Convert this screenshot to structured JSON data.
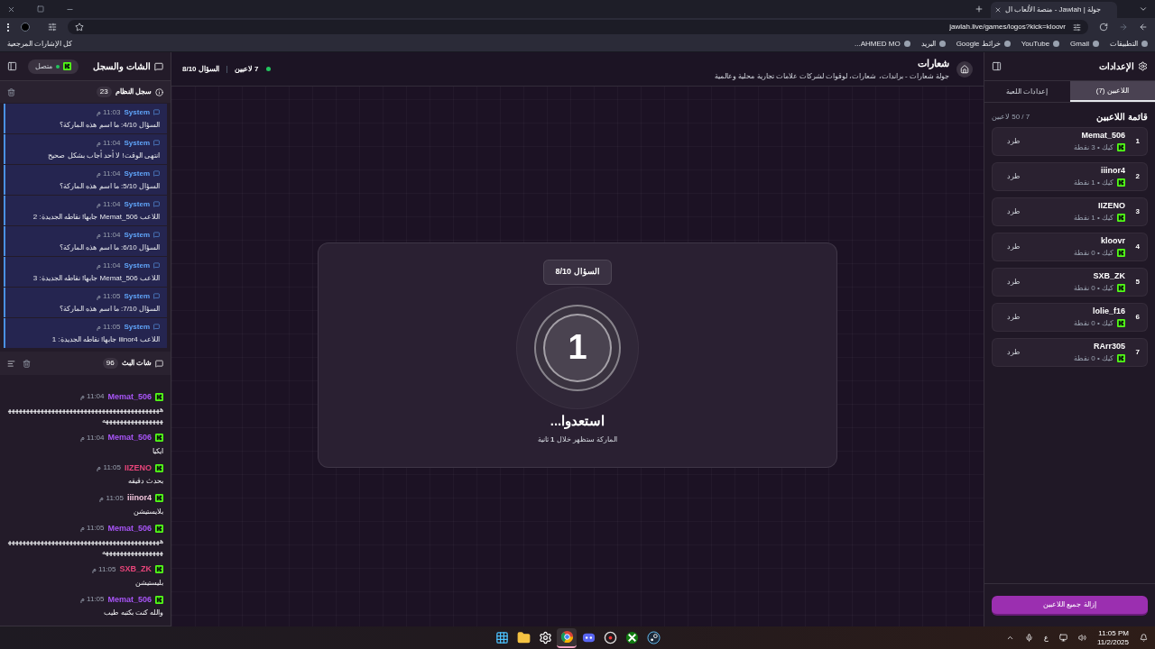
{
  "browser": {
    "tab": {
      "title": "جولة | Jawlah - منصة الألعاب ال",
      "selected": true
    },
    "address": "jawlah.live/games/logos?kick=kloovr",
    "bookmarks": [
      "التطبيقات",
      "Gmail",
      "YouTube",
      "خرائط Google",
      "البريد",
      "AHMED MO..."
    ],
    "all_bookmarks": "كل الإشارات المرجعية"
  },
  "settings": {
    "title": "الإعدادات",
    "tabs": [
      {
        "label": "اللاعبين (7)",
        "selected": true
      },
      {
        "label": "إعدادات اللعبة",
        "selected": false
      }
    ],
    "list_title": "قائمة اللاعبين",
    "count": "7 / 50 لاعبين",
    "players": [
      {
        "rank": "1",
        "name": "Memat_506",
        "meta": "كيك • 3 نقطة",
        "kick": "طرد"
      },
      {
        "rank": "2",
        "name": "iiinor4",
        "meta": "كيك • 1 نقطة",
        "kick": "طرد"
      },
      {
        "rank": "3",
        "name": "IIZENO",
        "meta": "كيك • 1 نقطة",
        "kick": "طرد"
      },
      {
        "rank": "4",
        "name": "kloovr",
        "meta": "كيك • 0 نقطة",
        "kick": "طرد"
      },
      {
        "rank": "5",
        "name": "SXB_ZK",
        "meta": "كيك • 0 نقطة",
        "kick": "طرد"
      },
      {
        "rank": "6",
        "name": "lolie_f16",
        "meta": "كيك • 0 نقطة",
        "kick": "طرد"
      },
      {
        "rank": "7",
        "name": "RArr305",
        "meta": "كيك • 0 نقطة",
        "kick": "طرد"
      }
    ],
    "remove_all": "إزالة جميع اللاعبين"
  },
  "game": {
    "title": "شعارات",
    "subtitle": "جولة شعارات - براندات، شعارات، لوقوات لشركات علامات تجارية محلية وعالمية",
    "players": "7 لاعبين",
    "question": "السؤال 8/10",
    "card": {
      "badge": "السؤال 8/10",
      "countdown": "1",
      "heading": "استعدوا...",
      "hint": "الماركة ستظهر خلال **1** ثانية"
    }
  },
  "chat": {
    "title": "الشات والسجل",
    "status": "متصل",
    "online": true,
    "log": {
      "title": "سجل النظام",
      "count": "23",
      "messages": [
        {
          "sender": "System",
          "time": "11:03 م",
          "text": "السؤال 4/10: ما اسم هذه الماركة؟"
        },
        {
          "sender": "System",
          "time": "11:04 م",
          "text": "انتهى الوقت! لا أحد أجاب بشكل صحيح"
        },
        {
          "sender": "System",
          "time": "11:04 م",
          "text": "السؤال 5/10: ما اسم هذه الماركة؟"
        },
        {
          "sender": "System",
          "time": "11:04 م",
          "text": "اللاعب Memat_506 جابها! نقاطه الجديدة: 2"
        },
        {
          "sender": "System",
          "time": "11:04 م",
          "text": "السؤال 6/10: ما اسم هذه الماركة؟"
        },
        {
          "sender": "System",
          "time": "11:04 م",
          "text": "اللاعب Memat_506 جابها! نقاطه الجديدة: 3"
        },
        {
          "sender": "System",
          "time": "11:05 م",
          "text": "السؤال 7/10: ما اسم هذه الماركة؟"
        },
        {
          "sender": "System",
          "time": "11:05 م",
          "text": "اللاعب iiinor4 جابها! نقاطه الجديدة: 1"
        }
      ]
    },
    "stream": {
      "title": "شات البث",
      "count": "96",
      "messages": [
        {
          "user": "Memat_506",
          "color": "#a855f7",
          "time": "11:04 م",
          "text": "هههههههههههههههههههههههههههههههههههههههههههههههههههههههههههه"
        },
        {
          "user": "Memat_506",
          "color": "#a855f7",
          "time": "11:04 م",
          "text": "ايكيا"
        },
        {
          "user": "IIZENO",
          "color": "#e8457a",
          "time": "11:05 م",
          "text": "بحدث دقيقه"
        },
        {
          "user": "iiinor4",
          "color": "#f3c6dc",
          "time": "11:05 م",
          "text": "بلايستيشن"
        },
        {
          "user": "Memat_506",
          "color": "#a855f7",
          "time": "11:05 م",
          "text": "هههههههههههههههههههههههههههههههههههههههههههههههههههههههههههه"
        },
        {
          "user": "SXB_ZK",
          "color": "#e8457a",
          "time": "11:05 م",
          "text": "بليستيشن"
        },
        {
          "user": "Memat_506",
          "color": "#a855f7",
          "time": "11:05 م",
          "text": "والله كنت بكتبه طيب"
        }
      ]
    }
  },
  "taskbar": {
    "apps": [
      {
        "kind": "start",
        "selected": false
      },
      {
        "kind": "files",
        "selected": false
      },
      {
        "kind": "gear",
        "selected": false
      },
      {
        "kind": "browser",
        "selected": true
      },
      {
        "kind": "chat",
        "selected": false
      },
      {
        "kind": "media",
        "selected": false
      },
      {
        "kind": "xbox",
        "selected": false
      },
      {
        "kind": "steam",
        "selected": false
      }
    ],
    "lang": "ع",
    "time": "11:05 PM",
    "date": "11/2/2025"
  }
}
